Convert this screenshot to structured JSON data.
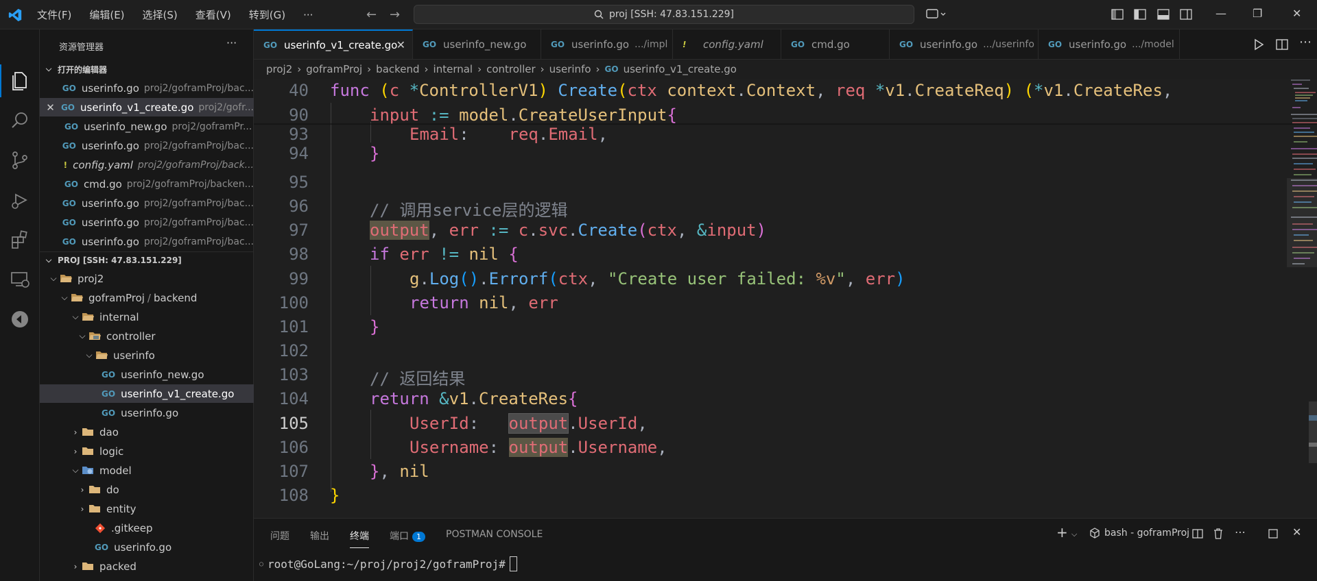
{
  "titlebar": {
    "menu": [
      "文件(F)",
      "编辑(E)",
      "选择(S)",
      "查看(V)",
      "转到(G)",
      "···"
    ],
    "search_text": "proj [SSH: 47.83.151.229]"
  },
  "sidebar": {
    "title": "资源管理器",
    "more": "···",
    "open_editors_title": "打开的编辑器",
    "open_editors": [
      {
        "name": "userinfo.go",
        "path": "proj2/goframProj/bac..."
      },
      {
        "name": "userinfo_v1_create.go",
        "path": "proj2/gofr..."
      },
      {
        "name": "userinfo_new.go",
        "path": "proj2/goframPr..."
      },
      {
        "name": "userinfo.go",
        "path": "proj2/goframProj/bac..."
      },
      {
        "name": "config.yaml",
        "path": "proj2/goframProj/back..."
      },
      {
        "name": "cmd.go",
        "path": "proj2/goframProj/backen..."
      },
      {
        "name": "userinfo.go",
        "path": "proj2/goframProj/bac..."
      },
      {
        "name": "userinfo.go",
        "path": "proj2/goframProj/bac..."
      },
      {
        "name": "userinfo.go",
        "path": "proj2/goframProj/bac..."
      }
    ],
    "project_title": "PROJ [SSH: 47.83.151.229]",
    "tree": {
      "proj2": "proj2",
      "gofram_a": "goframProj",
      "gofram_sep": "/",
      "gofram_b": "backend",
      "internal": "internal",
      "controller": "controller",
      "userinfo": "userinfo",
      "f1": "userinfo_new.go",
      "f2": "userinfo_v1_create.go",
      "f3": "userinfo.go",
      "dao": "dao",
      "logic": "logic",
      "model": "model",
      "do": "do",
      "entity": "entity",
      "gitkeep": ".gitkeep",
      "model_userinfo": "userinfo.go",
      "packed": "packed"
    }
  },
  "tabs": [
    {
      "name": "userinfo_v1_create.go",
      "desc": "",
      "close": "✕"
    },
    {
      "name": "userinfo_new.go",
      "desc": ""
    },
    {
      "name": "userinfo.go",
      "desc": ".../impl"
    },
    {
      "name": "config.yaml",
      "desc": ""
    },
    {
      "name": "cmd.go",
      "desc": ""
    },
    {
      "name": "userinfo.go",
      "desc": ".../userinfo"
    },
    {
      "name": "userinfo.go",
      "desc": ".../model"
    }
  ],
  "breadcrumb": [
    "proj2",
    "goframProj",
    "backend",
    "internal",
    "controller",
    "userinfo",
    "userinfo_v1_create.go"
  ],
  "line_numbers": [
    "40",
    "90",
    "93",
    "94",
    "95",
    "96",
    "97",
    "98",
    "99",
    "100",
    "101",
    "102",
    "103",
    "104",
    "105",
    "106",
    "107",
    "108"
  ],
  "code": {
    "l40": [
      "func",
      "(",
      "c",
      "*",
      "ControllerV1",
      ")",
      "Create",
      "(",
      "ctx",
      "context",
      ".",
      "Context",
      ", ",
      "req",
      "*",
      "v1",
      ".",
      "CreateReq",
      ")",
      "(",
      "*",
      "v1",
      ".",
      "CreateRes",
      ","
    ],
    "l90": [
      "input",
      ":=",
      "model",
      ".",
      "CreateUserInput",
      "{"
    ],
    "l93": [
      "Email",
      ":",
      "req",
      ".",
      "Email",
      ","
    ],
    "l94": [
      "}"
    ],
    "l96": "// 调用service层的逻辑",
    "l97": [
      "output",
      ", ",
      "err",
      ":=",
      "c",
      ".",
      "svc",
      ".",
      "Create",
      "(",
      "ctx",
      ", ",
      "&",
      "input",
      ")"
    ],
    "l98": [
      "if",
      "err",
      "!=",
      "nil",
      "{"
    ],
    "l99": [
      "g",
      ".",
      "Log",
      "()",
      ".",
      "Errorf",
      "(",
      "ctx",
      ", ",
      "\"Create user failed: ",
      "%v",
      "\"",
      ", ",
      "err",
      ")"
    ],
    "l100": [
      "return",
      "nil",
      ", ",
      "err"
    ],
    "l101": [
      "}"
    ],
    "l103": "// 返回结果",
    "l104": [
      "return",
      "&",
      "v1",
      ".",
      "CreateRes",
      "{"
    ],
    "l105": [
      "UserId",
      ":",
      "output",
      ".",
      "UserId",
      ","
    ],
    "l106": [
      "Username",
      ":",
      "output",
      ".",
      "Username",
      ","
    ],
    "l107": [
      "}",
      ", ",
      "nil"
    ],
    "l108": [
      "}"
    ]
  },
  "panel": {
    "tabs": [
      "问题",
      "输出",
      "终端",
      "端口",
      "POSTMAN CONSOLE"
    ],
    "ports_badge": "1",
    "terminal_name": "bash - goframProj",
    "prompt": "root@GoLang:~/proj/proj2/goframProj#"
  },
  "colors": {
    "accent": "#0078d4",
    "keyword": "#c678dd",
    "function": "#61afef",
    "type": "#e5c07b",
    "variable": "#e06c75",
    "string": "#98c379"
  }
}
